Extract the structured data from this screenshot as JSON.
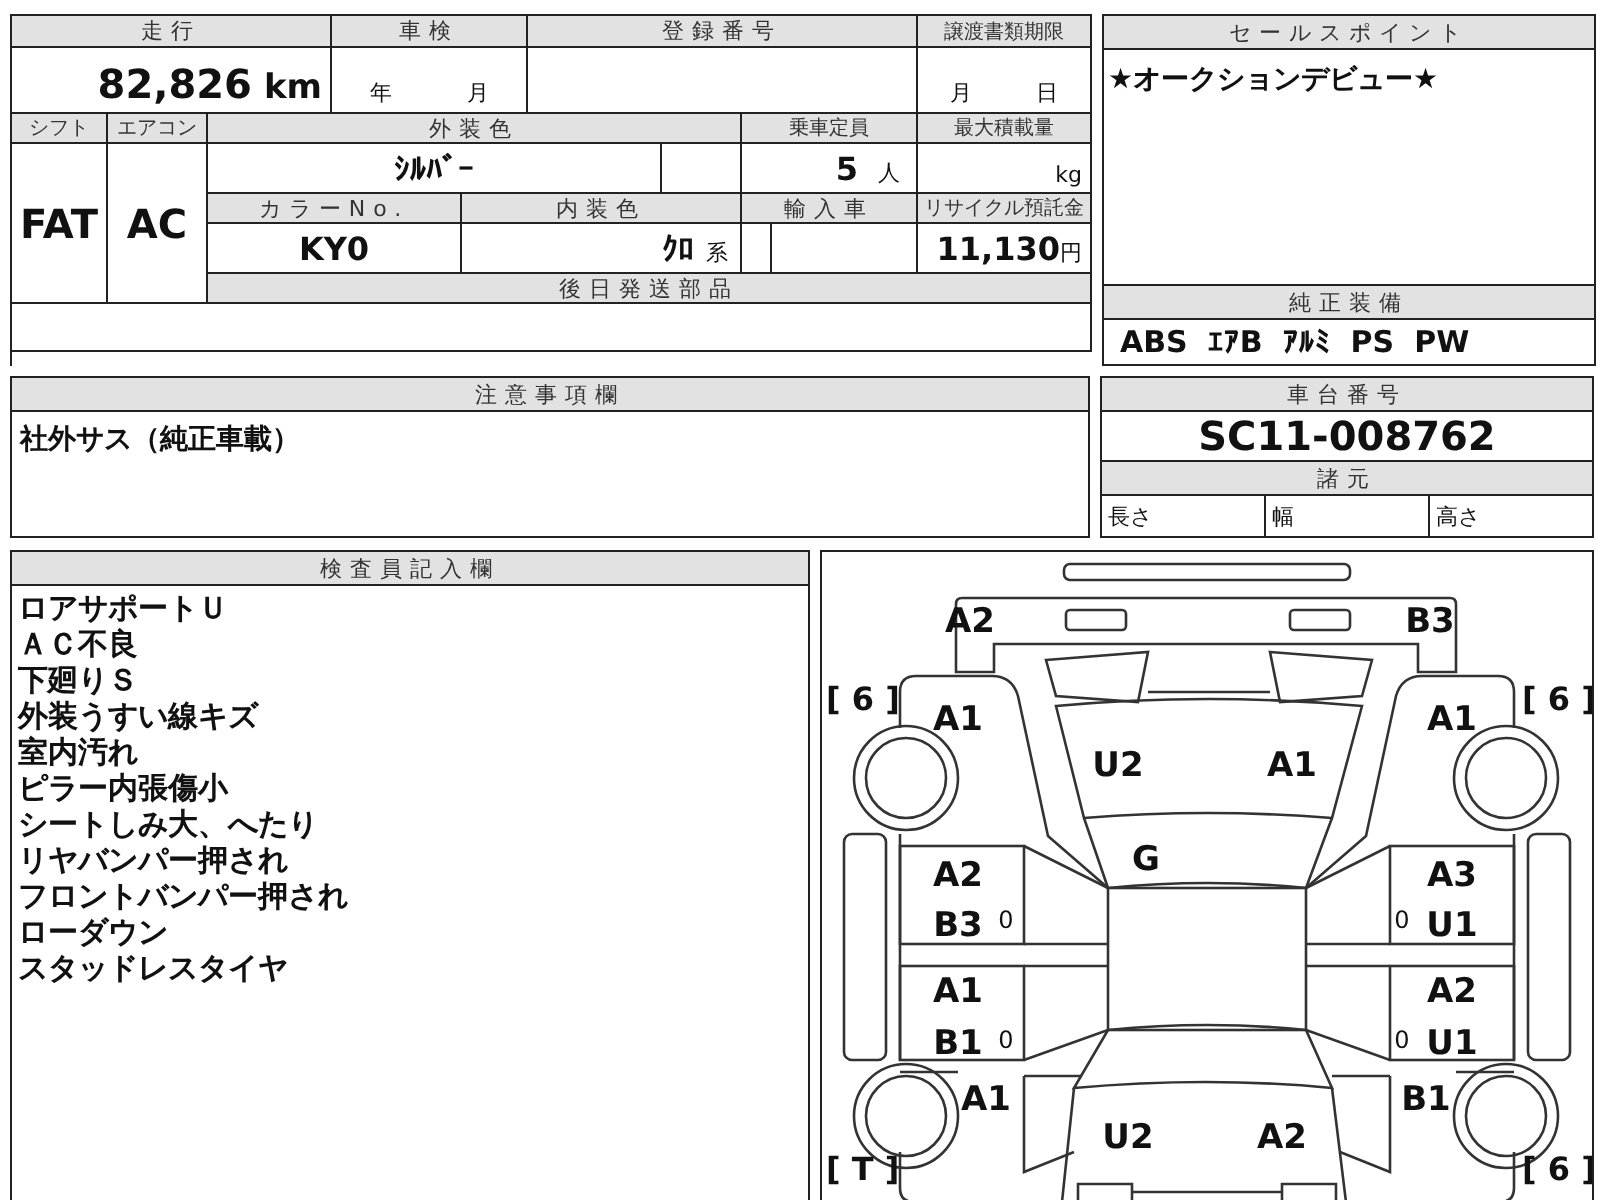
{
  "sheet": {
    "mileage": {
      "label": "走行",
      "value": "82,826",
      "unit": "km"
    },
    "inspection_expiry": {
      "label": "車検",
      "year_unit": "年",
      "month_unit": "月"
    },
    "registration_number": {
      "label": "登録番号"
    },
    "transfer_deadline": {
      "label": "譲渡書類期限",
      "month_unit": "月",
      "day_unit": "日"
    },
    "shift": {
      "label": "シフト",
      "value": "FAT"
    },
    "aircon": {
      "label": "エアコン",
      "value": "AC"
    },
    "exterior_color": {
      "label": "外装色",
      "value": "ｼﾙﾊﾞｰ"
    },
    "capacity": {
      "label": "乗車定員",
      "value": "5",
      "unit": "人"
    },
    "max_load": {
      "label": "最大積載量",
      "unit": "kg"
    },
    "color_no": {
      "label": "カラーNo.",
      "value": "KY0"
    },
    "interior_color": {
      "label": "内装色",
      "value": "ｸﾛ",
      "suffix": "系"
    },
    "imported": {
      "label": "輸入車"
    },
    "recycle_fee": {
      "label": "リサイクル預託金",
      "value": "11,130",
      "unit": "円"
    },
    "later_parts": {
      "label": "後日発送部品"
    }
  },
  "sales_point": {
    "label": "セールスポイント",
    "text": "★オークションデビュー★"
  },
  "equipment": {
    "label": "純正装備",
    "items": [
      "ABS",
      "ｴｱB",
      "ｱﾙﾐ",
      "PS",
      "PW"
    ]
  },
  "notes": {
    "label": "注意事項欄",
    "text": "社外サス（純正車載）"
  },
  "chassis": {
    "label": "車台番号",
    "value": "SC11-008762"
  },
  "specs": {
    "label": "諸元",
    "fields": [
      "長さ",
      "幅",
      "高さ"
    ]
  },
  "inspector": {
    "label": "検査員記入欄",
    "lines": [
      "ロアサポートＵ",
      "ＡＣ不良",
      "下廻りＳ",
      "外装うすい線キズ",
      "室内汚れ",
      "ピラー内張傷小",
      "シートしみ大、へたり",
      "リヤバンパー押され",
      "フロントバンパー押され",
      "ローダウン",
      "スタッドレスタイヤ"
    ]
  },
  "diagram": {
    "marks": [
      {
        "kind": "grade",
        "text": "A2"
      },
      {
        "kind": "grade",
        "text": "B3"
      },
      {
        "kind": "tire",
        "text": "[ 6 ]"
      },
      {
        "kind": "grade",
        "text": "A1"
      },
      {
        "kind": "tire",
        "text": "[ 6 ]"
      },
      {
        "kind": "grade",
        "text": "A1"
      },
      {
        "kind": "grade",
        "text": "U2"
      },
      {
        "kind": "grade",
        "text": "A1"
      },
      {
        "kind": "grade",
        "text": "G"
      },
      {
        "kind": "grade",
        "text": "A2"
      },
      {
        "kind": "grade",
        "text": "B3"
      },
      {
        "kind": "small",
        "text": "0"
      },
      {
        "kind": "grade",
        "text": "A3"
      },
      {
        "kind": "small",
        "text": "0"
      },
      {
        "kind": "grade",
        "text": "U1"
      },
      {
        "kind": "grade",
        "text": "A1"
      },
      {
        "kind": "grade",
        "text": "B1"
      },
      {
        "kind": "small",
        "text": "0"
      },
      {
        "kind": "grade",
        "text": "A2"
      },
      {
        "kind": "small",
        "text": "0"
      },
      {
        "kind": "grade",
        "text": "U1"
      },
      {
        "kind": "grade",
        "text": "A1"
      },
      {
        "kind": "grade",
        "text": "B1"
      },
      {
        "kind": "grade",
        "text": "U2"
      },
      {
        "kind": "grade",
        "text": "A2"
      },
      {
        "kind": "tire",
        "text": "[ T ]"
      },
      {
        "kind": "tire",
        "text": "[ 6 ]"
      }
    ]
  }
}
